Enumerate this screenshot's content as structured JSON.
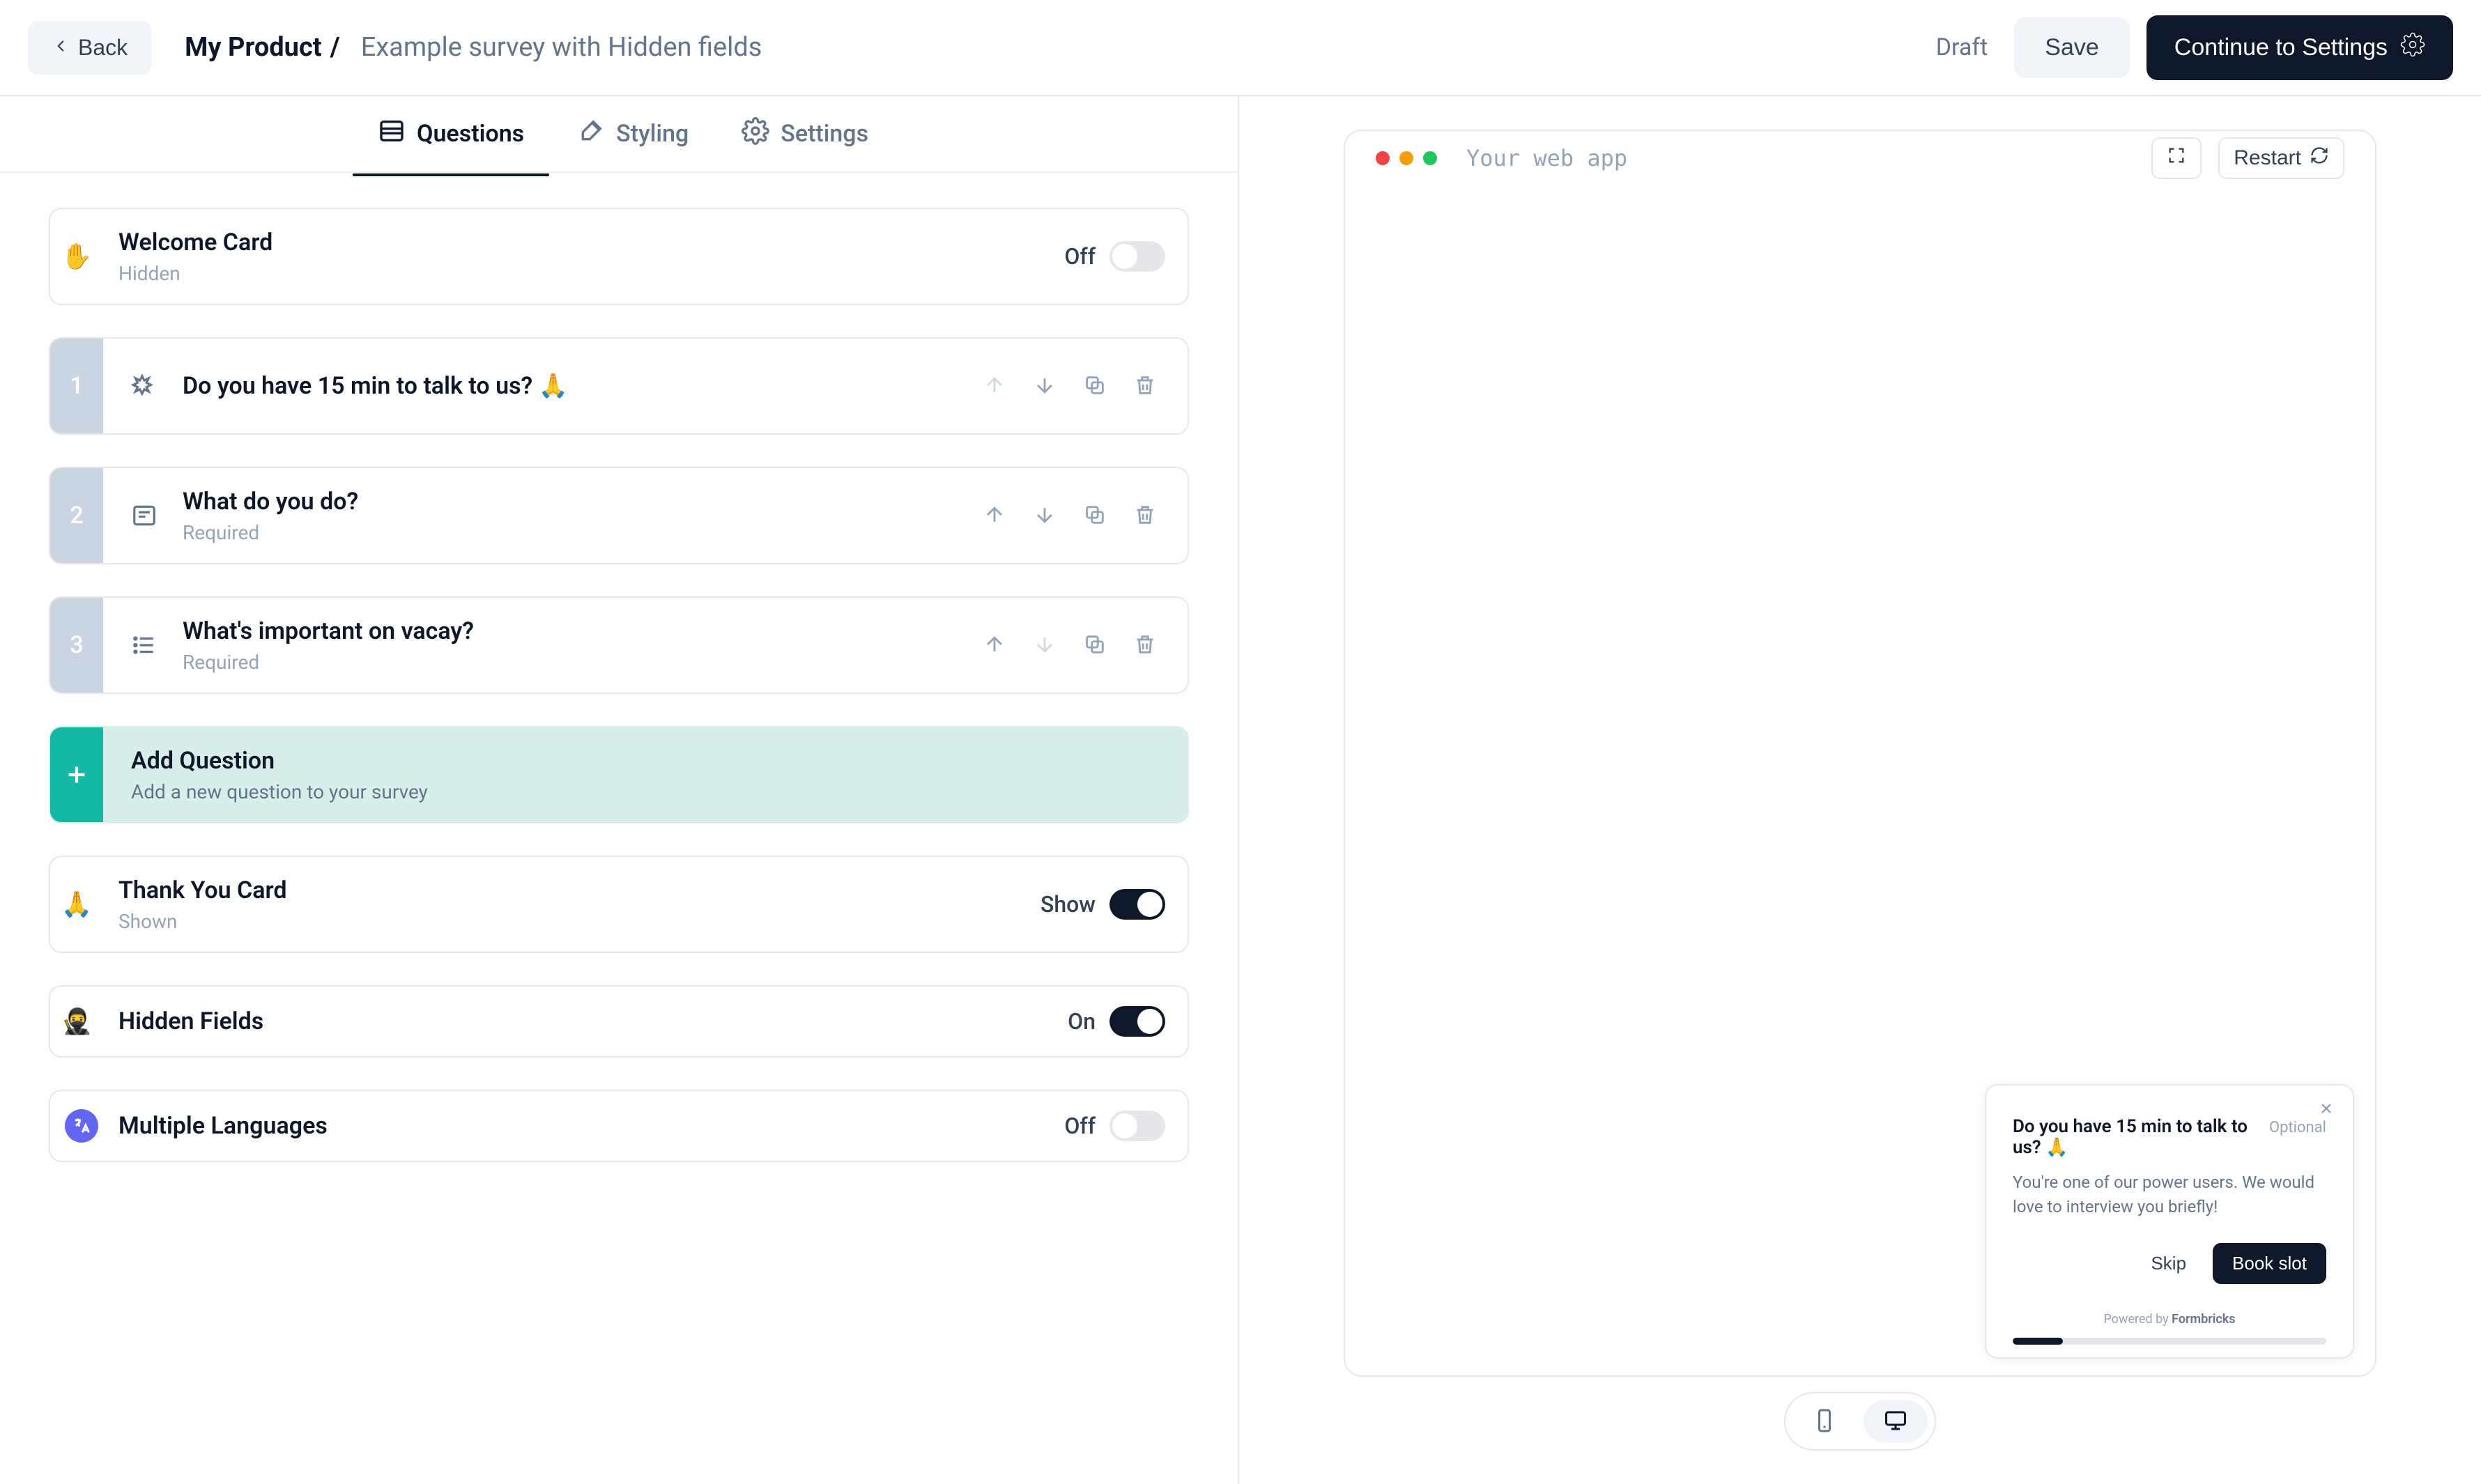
{
  "header": {
    "back_label": "Back",
    "product_name": "My Product",
    "survey_name": "Example survey with Hidden fields",
    "status": "Draft",
    "save_label": "Save",
    "continue_label": "Continue to Settings"
  },
  "tabs": {
    "questions": "Questions",
    "styling": "Styling",
    "settings": "Settings",
    "active": "questions"
  },
  "cards": {
    "welcome": {
      "title": "Welcome Card",
      "sub": "Hidden",
      "toggle_label": "Off",
      "on": false,
      "emoji": "✋"
    },
    "questions": [
      {
        "num": "1",
        "title": "Do you have 15 min to talk to us? 🙏",
        "sub": "",
        "icon": "cta",
        "move_up": false,
        "move_down": true
      },
      {
        "num": "2",
        "title": "What do you do?",
        "sub": "Required",
        "icon": "text",
        "move_up": true,
        "move_down": true
      },
      {
        "num": "3",
        "title": "What's important on vacay?",
        "sub": "Required",
        "icon": "list",
        "move_up": true,
        "move_down": false
      }
    ],
    "add": {
      "title": "Add Question",
      "sub": "Add a new question to your survey"
    },
    "thankyou": {
      "title": "Thank You Card",
      "sub": "Shown",
      "toggle_label": "Show",
      "on": true,
      "emoji": "🙏"
    },
    "hidden_fields": {
      "title": "Hidden Fields",
      "toggle_label": "On",
      "on": true,
      "emoji": "🥷"
    },
    "languages": {
      "title": "Multiple Languages",
      "toggle_label": "Off",
      "on": false
    }
  },
  "preview": {
    "browser_title": "Your web app",
    "restart_label": "Restart",
    "popup": {
      "title": "Do you have 15 min to talk to us? 🙏",
      "optional": "Optional",
      "body": "You're one of our power users. We would love to interview you briefly!",
      "skip_label": "Skip",
      "cta_label": "Book slot",
      "powered_pre": "Powered by ",
      "powered_brand": "Formbricks",
      "progress_pct": 16
    }
  }
}
